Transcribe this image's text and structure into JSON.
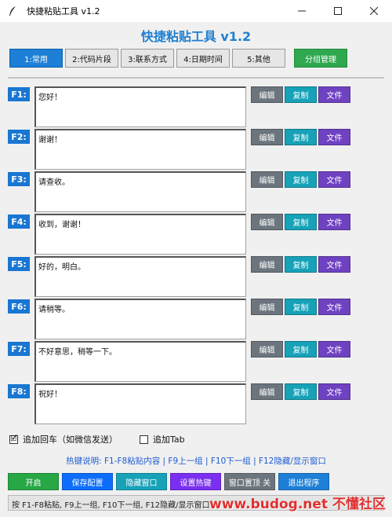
{
  "window": {
    "title": "快捷粘贴工具 v1.2"
  },
  "app": {
    "title": "快捷粘贴工具 v1.2"
  },
  "tabs": [
    {
      "label": "1:常用"
    },
    {
      "label": "2:代码片段"
    },
    {
      "label": "3:联系方式"
    },
    {
      "label": "4:日期时间"
    },
    {
      "label": "5:其他"
    }
  ],
  "group_button": "分组管理",
  "row_buttons": {
    "edit": "编辑",
    "copy": "复制",
    "file": "文件"
  },
  "colors": {
    "accent": "#1e7fd6",
    "edit": "#6c757d",
    "copy": "#17a2b8",
    "file": "#6f42c1",
    "start": "#28a745",
    "save": "#0d6efd",
    "hide": "#17a2b8",
    "hotkey": "#7a2ff0",
    "pin": "#6c757d",
    "exit": "#1e7fd6"
  },
  "rows": [
    {
      "key": "F1:",
      "text": "您好！"
    },
    {
      "key": "F2:",
      "text": "谢谢！"
    },
    {
      "key": "F3:",
      "text": "请查收。"
    },
    {
      "key": "F4:",
      "text": "收到，谢谢！"
    },
    {
      "key": "F5:",
      "text": "好的，明白。"
    },
    {
      "key": "F6:",
      "text": "请稍等。"
    },
    {
      "key": "F7:",
      "text": "不好意思，稍等一下。"
    },
    {
      "key": "F8:",
      "text": "祝好！"
    }
  ],
  "options": {
    "enter": {
      "label": "追加回车（如微信发送）",
      "checked": "🗹"
    },
    "tab": {
      "label": "追加Tab"
    }
  },
  "hotkey_note": "热键说明: F1-F8粘贴内容 | F9上一组 | F10下一组 | F12隐藏/显示窗口",
  "bottom_buttons": [
    "开启",
    "保存配置",
    "隐藏窗口",
    "设置热键",
    "窗口置顶 关",
    "退出程序"
  ],
  "status_text": "按 F1-F8粘贴, F9上一组, F10下一组, F12隐藏/显示窗口",
  "watermark": "www.budog.net 不懂社区"
}
